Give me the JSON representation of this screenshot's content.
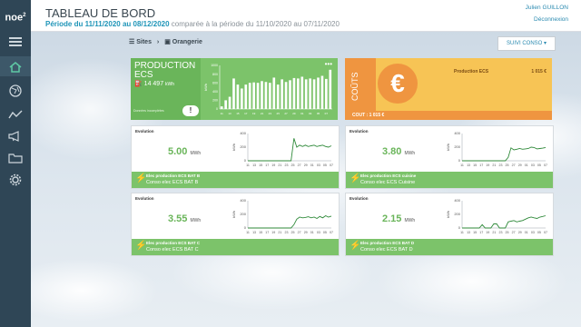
{
  "header": {
    "logo": "noe",
    "logo_sup": "2",
    "title": "TABLEAU DE BORD",
    "period_bold": "Période du 11/11/2020 au 08/12/2020",
    "period_rest": " comparée à la période du 11/10/2020 au 07/11/2020",
    "user": "Julien GUILLON",
    "logout": "Déconnexion"
  },
  "breadcrumb": {
    "root": "Sites",
    "current": "Orangerie"
  },
  "dropdown": {
    "value": "SUIVI CONSO"
  },
  "production_tile": {
    "title": "PRODUCTION ECS",
    "value": "14 497",
    "unit": "kWh",
    "footer": "Données incomplètes",
    "alert": "!",
    "menu": "•••",
    "ylabel": "kWh",
    "ticks_y": [
      "0",
      "200",
      "400",
      "600",
      "800",
      "1000"
    ]
  },
  "cost_tile": {
    "vertical_label": "COÛTS",
    "symbol": "€",
    "label": "Production ECS",
    "value": "1 015 €",
    "footer": "COUT : 1 015 €"
  },
  "cards": [
    {
      "label": "Evolution",
      "value": "5.00",
      "unit": "MWh",
      "line1": "Elec production ECS BAT B",
      "line2": "Conso elec ECS BAT B",
      "ylabel": "kWh",
      "yticks": [
        "0",
        "200",
        "400"
      ],
      "xticks": [
        "11",
        "13",
        "15",
        "17",
        "19",
        "21",
        "23",
        "25",
        "27",
        "29",
        "01",
        "03",
        "05",
        "07"
      ]
    },
    {
      "label": "Evolution",
      "value": "3.80",
      "unit": "MWh",
      "line1": "Elec production ECS cuisine",
      "line2": "Conso elec ECS Cuisine",
      "ylabel": "kWh",
      "yticks": [
        "0",
        "200",
        "400"
      ],
      "xticks": [
        "11",
        "13",
        "15",
        "17",
        "19",
        "21",
        "23",
        "25",
        "27",
        "29",
        "01",
        "03",
        "05",
        "07"
      ]
    },
    {
      "label": "Evolution",
      "value": "3.55",
      "unit": "MWh",
      "line1": "Elec production ECS BAT C",
      "line2": "Conso elec ECS BAT C",
      "ylabel": "kWh",
      "yticks": [
        "0",
        "200",
        "400"
      ],
      "xticks": [
        "11",
        "13",
        "15",
        "17",
        "19",
        "21",
        "23",
        "25",
        "27",
        "29",
        "01",
        "03",
        "05",
        "07"
      ]
    },
    {
      "label": "Evolution",
      "value": "2.15",
      "unit": "MWh",
      "line1": "Elec production ECS BAT D",
      "line2": "Conso elec ECS BAT D",
      "ylabel": "kWh",
      "yticks": [
        "0",
        "200",
        "400"
      ],
      "xticks": [
        "11",
        "13",
        "15",
        "17",
        "19",
        "21",
        "23",
        "25",
        "27",
        "29",
        "01",
        "03",
        "05",
        "07"
      ]
    }
  ],
  "chart_data": [
    {
      "type": "bar",
      "categories": [
        "11",
        "12",
        "13",
        "14",
        "15",
        "16",
        "17",
        "18",
        "19",
        "20",
        "21",
        "22",
        "23",
        "24",
        "25",
        "26",
        "27",
        "28",
        "29",
        "30",
        "01",
        "02",
        "03",
        "04",
        "05",
        "06",
        "07",
        "08"
      ],
      "values": [
        60,
        200,
        280,
        700,
        560,
        470,
        560,
        600,
        610,
        600,
        640,
        620,
        600,
        720,
        560,
        680,
        620,
        660,
        710,
        700,
        740,
        680,
        700,
        680,
        720,
        760,
        690,
        900
      ],
      "ylim": [
        0,
        1000
      ],
      "ylabel": "kWh"
    },
    {
      "type": "line",
      "series": [
        {
          "values": [
            0,
            0,
            0,
            0,
            0,
            0,
            0,
            0,
            0,
            0,
            0,
            0,
            0,
            0,
            0,
            0,
            330,
            200,
            230,
            210,
            230,
            210,
            220,
            230,
            210,
            220,
            230,
            210,
            200,
            220
          ]
        }
      ],
      "ylim": [
        0,
        400
      ],
      "ylabel": "kWh"
    },
    {
      "type": "line",
      "series": [
        {
          "values": [
            0,
            0,
            0,
            0,
            0,
            0,
            0,
            0,
            0,
            0,
            0,
            0,
            0,
            0,
            0,
            0,
            50,
            190,
            160,
            170,
            180,
            170,
            175,
            180,
            200,
            195,
            175,
            180,
            185,
            195
          ]
        }
      ],
      "ylim": [
        0,
        400
      ],
      "ylabel": "kWh"
    },
    {
      "type": "line",
      "series": [
        {
          "values": [
            0,
            0,
            0,
            0,
            0,
            0,
            0,
            0,
            0,
            0,
            0,
            0,
            0,
            0,
            0,
            0,
            50,
            130,
            160,
            150,
            155,
            165,
            150,
            160,
            140,
            170,
            150,
            180,
            160,
            175
          ]
        }
      ],
      "ylim": [
        0,
        400
      ],
      "ylabel": "kWh"
    },
    {
      "type": "line",
      "series": [
        {
          "values": [
            0,
            0,
            0,
            0,
            0,
            0,
            0,
            50,
            0,
            0,
            0,
            60,
            60,
            0,
            0,
            0,
            90,
            100,
            110,
            90,
            100,
            110,
            130,
            150,
            160,
            150,
            140,
            160,
            170,
            180
          ]
        }
      ],
      "ylim": [
        0,
        400
      ],
      "ylabel": "kWh"
    }
  ],
  "colors": {
    "green": "#6ab55a",
    "green_light": "#7cc36a",
    "orange": "#ef9540",
    "yellow": "#f7c455",
    "sidebar": "#2f4656",
    "blue": "#1f95b8"
  },
  "icons": [
    "menu-icon",
    "home-icon",
    "globe-icon",
    "trend-icon",
    "megaphone-icon",
    "folder-icon",
    "gear-icon"
  ]
}
